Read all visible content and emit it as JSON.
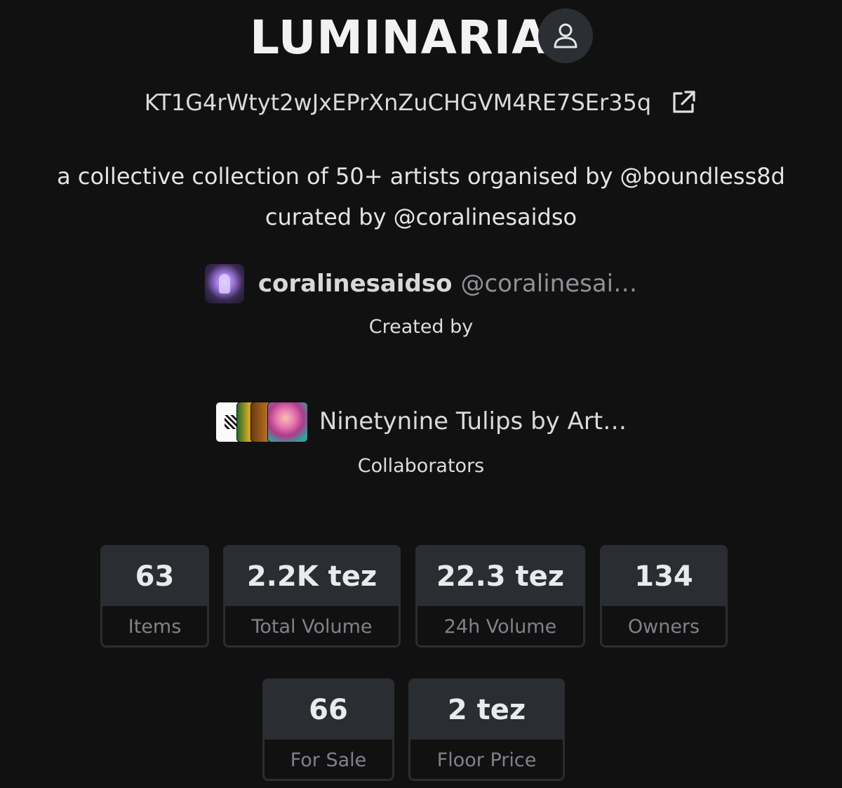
{
  "header": {
    "title": "LUMINARIA",
    "profile_icon": "user-icon"
  },
  "contract": {
    "address": "KT1G4rWtyt2wJxEPrXnZuCHGVM4RE7SEr35q",
    "link_icon": "external-link-icon"
  },
  "description": {
    "line1": "a collective collection of 50+ artists organised by @boundless8d",
    "line2": "curated by @coralinesaidso"
  },
  "creator": {
    "name": "coralinesaidso",
    "handle": "@coralinesai…",
    "label": "Created by"
  },
  "collaborators": {
    "name": "Ninetynine Tulips by Art…",
    "label": "Collaborators"
  },
  "stats": [
    {
      "value": "63",
      "label": "Items"
    },
    {
      "value": "2.2K tez",
      "label": "Total Volume"
    },
    {
      "value": "22.3 tez",
      "label": "24h Volume"
    },
    {
      "value": "134",
      "label": "Owners"
    },
    {
      "value": "66",
      "label": "For Sale"
    },
    {
      "value": "2 tez",
      "label": "Floor Price"
    }
  ],
  "colors": {
    "background": "#111111",
    "card": "#2a2d31",
    "muted_text": "#7f8389"
  }
}
